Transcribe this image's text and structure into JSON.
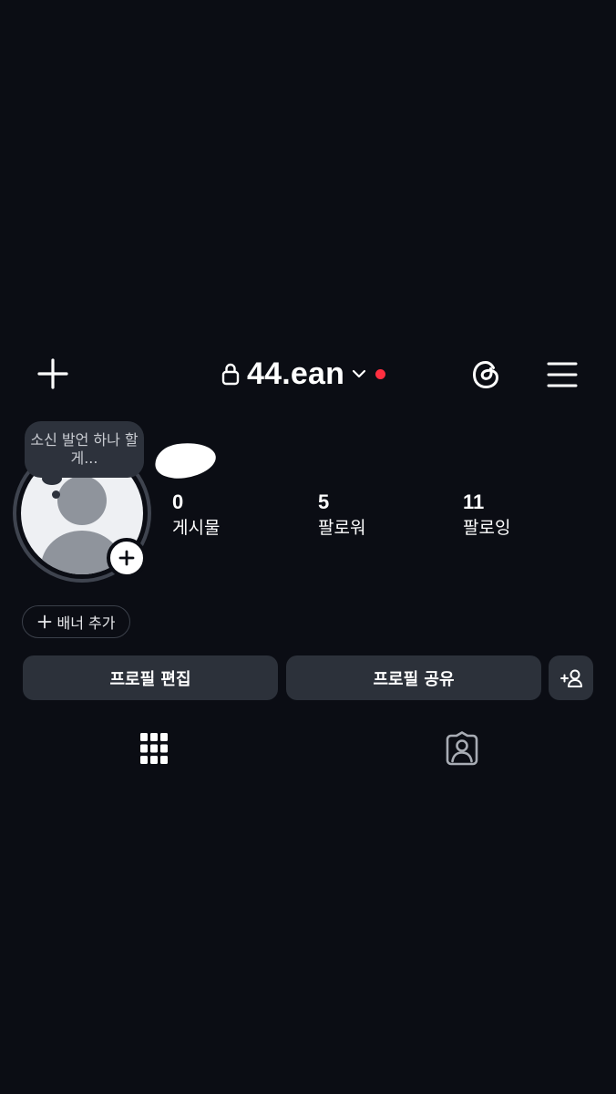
{
  "header": {
    "username": "44.ean",
    "icons": {
      "create": "plus-icon",
      "lock": "lock-icon",
      "account_switch": "chevron-down-icon",
      "threads": "threads-icon",
      "menu": "hamburger-menu-icon"
    },
    "notification_dot_color": "#ff2f40"
  },
  "profile": {
    "note_bubble": "소신 발언 하나 할게...",
    "stats": [
      {
        "value": "0",
        "label": "게시물"
      },
      {
        "value": "5",
        "label": "팔로워"
      },
      {
        "value": "11",
        "label": "팔로잉"
      }
    ]
  },
  "actions": {
    "banner_add_label": "배너 추가",
    "edit_profile_label": "프로필 편집",
    "share_profile_label": "프로필 공유",
    "discover_people_icon": "add-person-icon"
  },
  "tabs": {
    "posts_icon": "grid-icon",
    "tagged_icon": "tagged-person-icon"
  },
  "colors": {
    "background": "#0b0d14",
    "button_bg": "#2c313a",
    "accent_red": "#ff2f40"
  }
}
